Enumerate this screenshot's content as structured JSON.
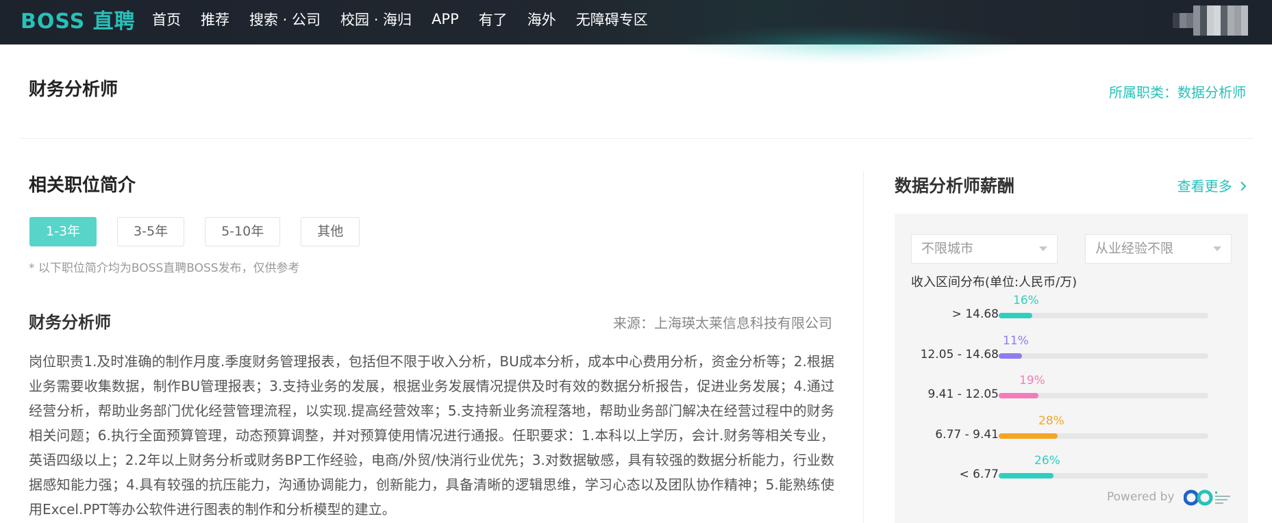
{
  "header": {
    "logo": "BOSS 直聘",
    "nav": [
      "首页",
      "推荐",
      "搜索 · 公司",
      "校园 · 海归",
      "APP",
      "有了",
      "海外",
      "无障碍专区"
    ]
  },
  "page": {
    "title": "财务分析师",
    "category": "所属职类：数据分析师"
  },
  "intro": {
    "title": "相关职位简介",
    "tabs": [
      "1-3年",
      "3-5年",
      "5-10年",
      "其他"
    ],
    "active_tab": "1-3年",
    "note": "* 以下职位简介均为BOSS直聘BOSS发布，仅供参考",
    "job_name": "财务分析师",
    "source": "来源：上海瑛太莱信息科技有限公司",
    "description": "岗位职责1.及时准确的制作月度.季度财务管理报表，包括但不限于收入分析，BU成本分析，成本中心费用分析，资金分析等；2.根据业务需要收集数据，制作BU管理报表；3.支持业务的发展，根据业务发展情况提供及时有效的数据分析报告，促进业务发展；4.通过经营分析，帮助业务部门优化经营管理流程，以实现.提高经营效率；5.支持新业务流程落地，帮助业务部门解决在经营过程中的财务相关问题；6.执行全面预算管理，动态预算调整，并对预算使用情况进行通报。任职要求：1.本科以上学历，会计.财务等相关专业，英语四级以上；2.2年以上财务分析或财务BP工作经验，电商/外贸/快消行业优先；3.对数据敏感，具有较强的数据分析能力，行业数据感知能力强；4.具有较强的抗压能力，沟通协调能力，创新能力，具备清晰的逻辑思维，学习心态以及团队协作精神；5.能熟练使用Excel.PPT等办公软件进行图表的制作和分析模型的建立。"
  },
  "salary": {
    "title": "数据分析师薪酬",
    "more": "查看更多",
    "city_select": "不限城市",
    "exp_select": "从业经验不限",
    "dist_title": "收入区间分布(单位:人民币/万)",
    "powered_by": "Powered by",
    "ranges": [
      {
        "label": "> 14.68",
        "pct": "16%",
        "value": 16,
        "color": "#2fcfc0"
      },
      {
        "label": "12.05 - 14.68",
        "pct": "11%",
        "value": 11,
        "color": "#8f7cf0"
      },
      {
        "label": "9.41 - 12.05",
        "pct": "19%",
        "value": 19,
        "color": "#f27dbc"
      },
      {
        "label": "6.77 - 9.41",
        "pct": "28%",
        "value": 28,
        "color": "#f5a623"
      },
      {
        "label": "< 6.77",
        "pct": "26%",
        "value": 26,
        "color": "#2fcfc0"
      }
    ]
  }
}
